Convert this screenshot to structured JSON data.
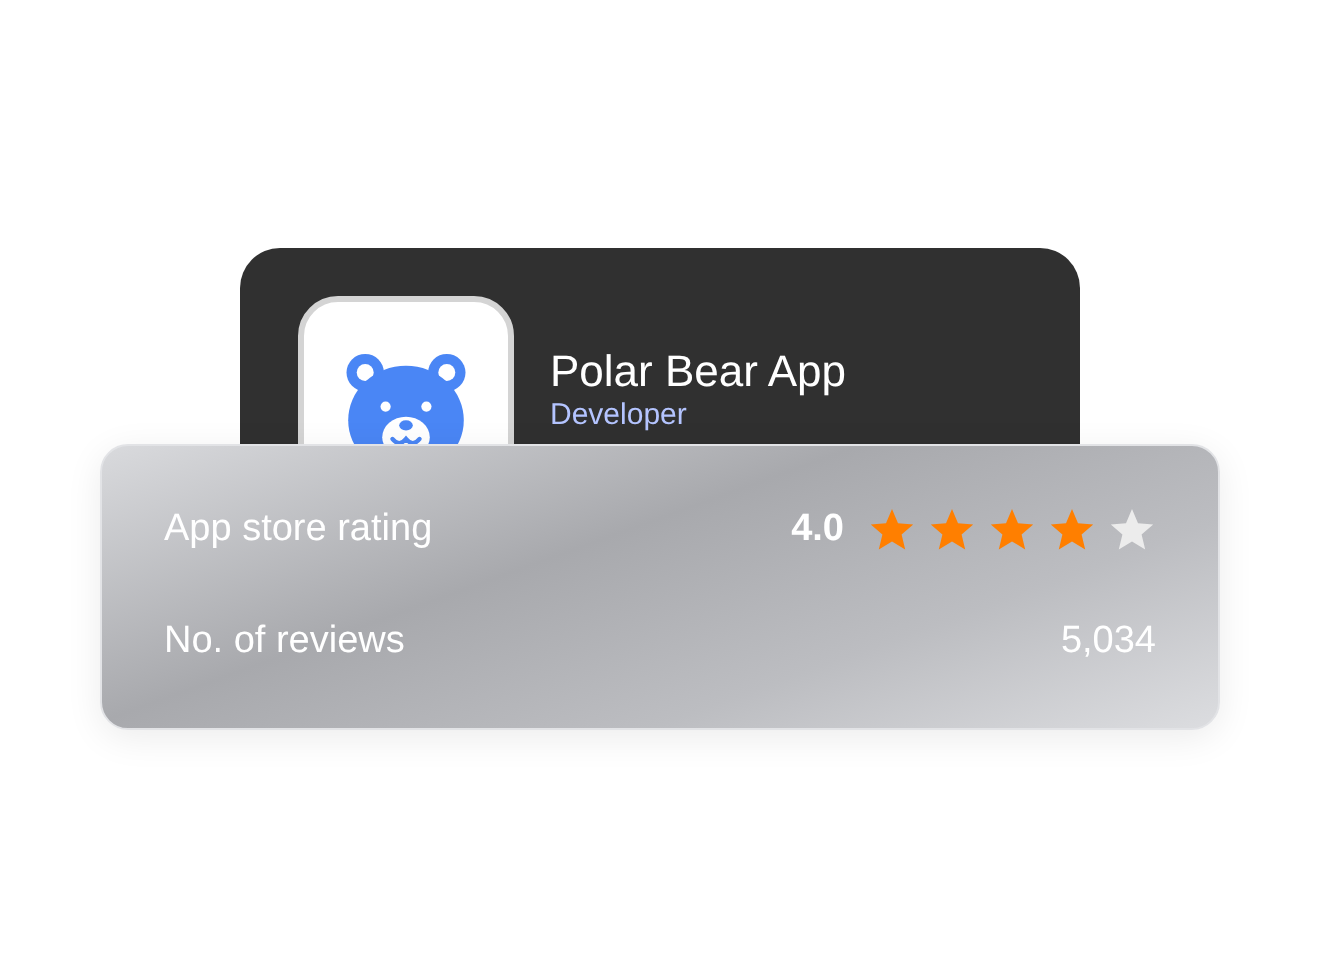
{
  "app": {
    "name": "Polar Bear App",
    "developer": "Developer"
  },
  "stats": [
    {
      "kind": "rating",
      "label": "App store rating",
      "value": "4.0",
      "stars": 4
    },
    {
      "kind": "count",
      "label": "No. of reviews",
      "value": "5,034"
    }
  ]
}
